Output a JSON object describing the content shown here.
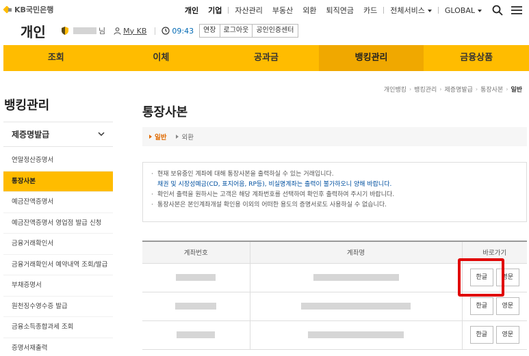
{
  "brand": {
    "logo_text": "KB국민은행",
    "accent": "#ffbc00",
    "highlight_color": "#e00000"
  },
  "header": {
    "section_title": "개인",
    "user_suffix": "님",
    "mykb_label": "My KB",
    "timer": "09:43",
    "buttons": [
      "연장",
      "로그아웃",
      "공인인증센터"
    ],
    "util_menu": [
      {
        "label": "개인",
        "bold": true
      },
      {
        "label": "기업",
        "bold": true
      },
      {
        "label": "자산관리"
      },
      {
        "label": "부동산"
      },
      {
        "label": "외환"
      },
      {
        "label": "퇴직연금"
      },
      {
        "label": "카드"
      },
      {
        "label": "전체서비스"
      },
      {
        "label": "GLOBAL"
      }
    ],
    "icons": [
      "shield-icon",
      "person-icon",
      "clock-icon",
      "search-icon",
      "menu-icon"
    ]
  },
  "main_nav": [
    {
      "label": "조회"
    },
    {
      "label": "이체"
    },
    {
      "label": "공과금"
    },
    {
      "label": "뱅킹관리",
      "active": true
    },
    {
      "label": "금융상품"
    }
  ],
  "breadcrumb": [
    "개인뱅킹",
    "뱅킹관리",
    "제증명발급",
    "통장사본",
    "일반"
  ],
  "sidebar": {
    "title": "뱅킹관리",
    "group": "제증명발급",
    "items": [
      {
        "label": "연말정산증명서"
      },
      {
        "label": "통장사본",
        "active": true
      },
      {
        "label": "예금잔액증명서"
      },
      {
        "label": "예금잔액증명서 영업점 발급 신청"
      },
      {
        "label": "금융거래확인서"
      },
      {
        "label": "금융거래확인서 예약내역 조회/발급"
      },
      {
        "label": "부채증명서"
      },
      {
        "label": "원천징수영수증 발급"
      },
      {
        "label": "금융소득종합과세 조회"
      },
      {
        "label": "증명서재출력"
      }
    ]
  },
  "main": {
    "page_title": "통장사본",
    "tabs": [
      {
        "label": "일반",
        "active": true
      },
      {
        "label": "외환"
      }
    ],
    "notice": {
      "line1": "현재 보유중인 계좌에 대해 통장사본을 출력하실 수 있는 거래입니다.",
      "line1_sub": "채권 및 시장성예금(CD, 표지어음, RP등), 비실명계좌는 출력이 불가하오니 양해 바랍니다.",
      "line2": "확인서 출력을 원하시는 고객은 해당 계좌번호를 선택하여 확인후 출력하여 주시기 바랍니다.",
      "line3": "통장사본은 본인계좌개설 확인용 이외의 어떠한 용도의 증명서로도 사용하실 수 없습니다."
    },
    "table": {
      "headers": [
        "계좌번호",
        "계좌명",
        "바로가기"
      ],
      "btn_korean": "한글",
      "btn_english": "영문",
      "rows": [
        {
          "id": 1
        },
        {
          "id": 2
        },
        {
          "id": 3
        }
      ]
    }
  }
}
